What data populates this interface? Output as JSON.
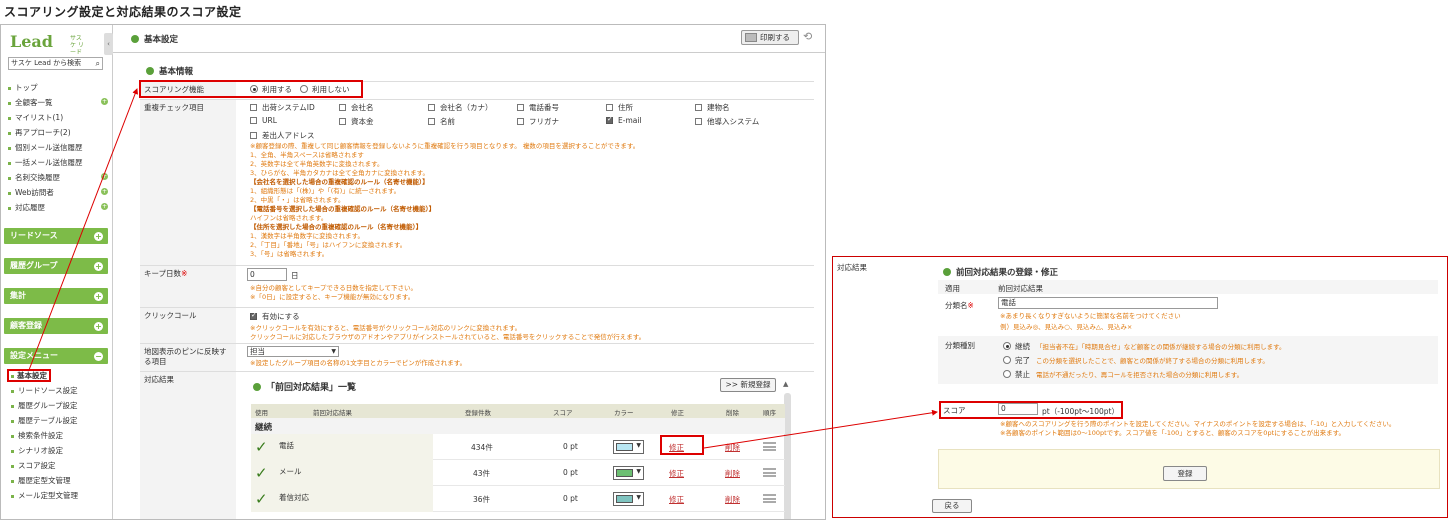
{
  "page_title": "スコアリング設定と対応結果のスコア設定",
  "sidebar": {
    "logo_text": "Lead",
    "logo_sub": "サスケ リード",
    "search_placeholder": "サスケ Lead から検索",
    "items": [
      {
        "label": "トップ"
      },
      {
        "label": "全顧客一覧"
      },
      {
        "label": "マイリスト(1)"
      },
      {
        "label": "再アプローチ(2)"
      },
      {
        "label": "個別メール送信履歴"
      },
      {
        "label": "一括メール送信履歴"
      },
      {
        "label": "名刺交換履歴"
      },
      {
        "label": "Web訪問者"
      },
      {
        "label": "対応履歴"
      }
    ],
    "sections": [
      {
        "label": "リードソース"
      },
      {
        "label": "履歴グループ"
      },
      {
        "label": "集計"
      },
      {
        "label": "顧客登録"
      },
      {
        "label": "設定メニュー"
      }
    ],
    "settings_items": [
      {
        "label": "基本設定"
      },
      {
        "label": "リードソース設定"
      },
      {
        "label": "履歴グループ設定"
      },
      {
        "label": "履歴テーブル設定"
      },
      {
        "label": "検索条件設定"
      },
      {
        "label": "シナリオ設定"
      },
      {
        "label": "スコア設定"
      },
      {
        "label": "履歴定型文管理"
      },
      {
        "label": "メール定型文管理"
      }
    ]
  },
  "main": {
    "header": "基本設定",
    "print_label": "印刷する",
    "section_title": "基本情報",
    "scoring": {
      "label": "スコアリング機能",
      "opt_on": "利用する",
      "opt_off": "利用しない"
    },
    "dup_check": {
      "label": "重複チェック項目",
      "options": [
        {
          "label": "出荷システムID",
          "checked": false
        },
        {
          "label": "会社名",
          "checked": false
        },
        {
          "label": "会社名（カナ）",
          "checked": false
        },
        {
          "label": "電話番号",
          "checked": false
        },
        {
          "label": "住所",
          "checked": false
        },
        {
          "label": "建物名",
          "checked": false
        },
        {
          "label": "URL",
          "checked": false
        },
        {
          "label": "資本金",
          "checked": false
        },
        {
          "label": "名前",
          "checked": false
        },
        {
          "label": "フリガナ",
          "checked": false
        },
        {
          "label": "E-mail",
          "checked": true
        },
        {
          "label": "他導入システム",
          "checked": false
        },
        {
          "label": "差出人アドレス",
          "checked": false
        }
      ],
      "notes": [
        "※顧客登録の際、重複して同じ顧客情報を登録しないように重複確認を行う項目となります。 複数の項目を選択することができます。",
        "1、全角、半角スペースは省略されます",
        "2、英数字は全て半角英数字に変換されます。",
        "3、ひらがな、半角カタカナは全て全角カナに変換されます。",
        "【会社名を選択した場合の重複確認のルール（名寄せ機能）】",
        "1、組織形態は「(株)」や「(有)」に統一されます。",
        "2、中黒「・」は省略されます。",
        "【電話番号を選択した場合の重複確認のルール（名寄せ機能）】",
        "ハイフンは省略されます。",
        "【住所を選択した場合の重複確認のルール（名寄せ機能）】",
        "1、漢数字は半角数字に変換されます。",
        "2、「丁目」「番地」「号」はハイフンに変換されます。",
        "3、「号」は省略されます。"
      ]
    },
    "keep": {
      "label": "キープ日数",
      "value": "0",
      "unit": "日",
      "notes": [
        "※自分の顧客としてキープできる日数を指定して下さい。",
        "※「0日」に設定すると、キープ機能が無効になります。"
      ]
    },
    "click_call": {
      "label": "クリックコール",
      "option": "有効にする",
      "notes": [
        "※クリックコールを有効にすると、電話番号がクリックコール対応のリンクに変換されます。",
        "クリックコールに対応したブラウザのアドオンやアプリがインストールされていると、電話番号をクリックすることで発信が行えます。"
      ]
    },
    "map_pin": {
      "label": "地図表示のピンに反映する項目",
      "value": "担当",
      "note": "※設定したグループ項目の名称の1文字目とカラーでピンが作成されます。"
    },
    "results": {
      "label": "対応結果",
      "list_title": "「前回対応結果」一覧",
      "new_button": ">> 新規登録",
      "columns": [
        "使用",
        "前回対応結果",
        "登録件数",
        "スコア",
        "カラー",
        "修正",
        "削除",
        "順序"
      ],
      "group": "継続",
      "edit_label": "修正",
      "delete_label": "削除",
      "rows": [
        {
          "name": "電話",
          "count": "434件",
          "score": "0 pt",
          "color": "#b8e6f2"
        },
        {
          "name": "メール",
          "count": "43件",
          "score": "0 pt",
          "color": "#6cbf72"
        },
        {
          "name": "着信対応",
          "count": "36件",
          "score": "0 pt",
          "color": "#7fc4c0"
        }
      ]
    }
  },
  "right_panel": {
    "label": "対応結果",
    "title": "前回対応結果の登録・修正",
    "apply_label": "適用",
    "apply_value": "前回対応結果",
    "class_name_label": "分類名",
    "class_name_value": "電話",
    "class_name_notes": [
      "※あまり長くなりすぎないように簡潔な名前をつけてください",
      "例）見込み◎、見込み○、見込み△、見込み×"
    ],
    "type_label": "分類種別",
    "types": [
      {
        "label": "継続",
        "desc": "「担当者不在」「時期見合せ」など顧客との関係が継続する場合の分類に利用します。",
        "selected": true
      },
      {
        "label": "完了",
        "desc": "この分類を選択したことで、顧客との関係が終了する場合の分類に利用します。",
        "selected": false
      },
      {
        "label": "禁止",
        "desc": "電話が不通だったり、再コールを拒否された場合の分類に利用します。",
        "selected": false
      }
    ],
    "score_label": "スコア",
    "score_value": "0",
    "score_unit": "pt（-100pt～100pt）",
    "score_notes": [
      "※顧客へのスコアリングを行う際のポイントを設定してください。マイナスのポイントを設定する場合は、「-10」と入力してください。",
      "※各顧客のポイント範囲は0～100ptです。スコア値を「-100」とすると、顧客のスコアを0ptにすることが出来ます。"
    ],
    "submit_label": "登録",
    "back_label": "戻る"
  },
  "colors": {
    "accent": "#7dbb48",
    "highlight": "#dd0000",
    "note": "#e07a10"
  }
}
